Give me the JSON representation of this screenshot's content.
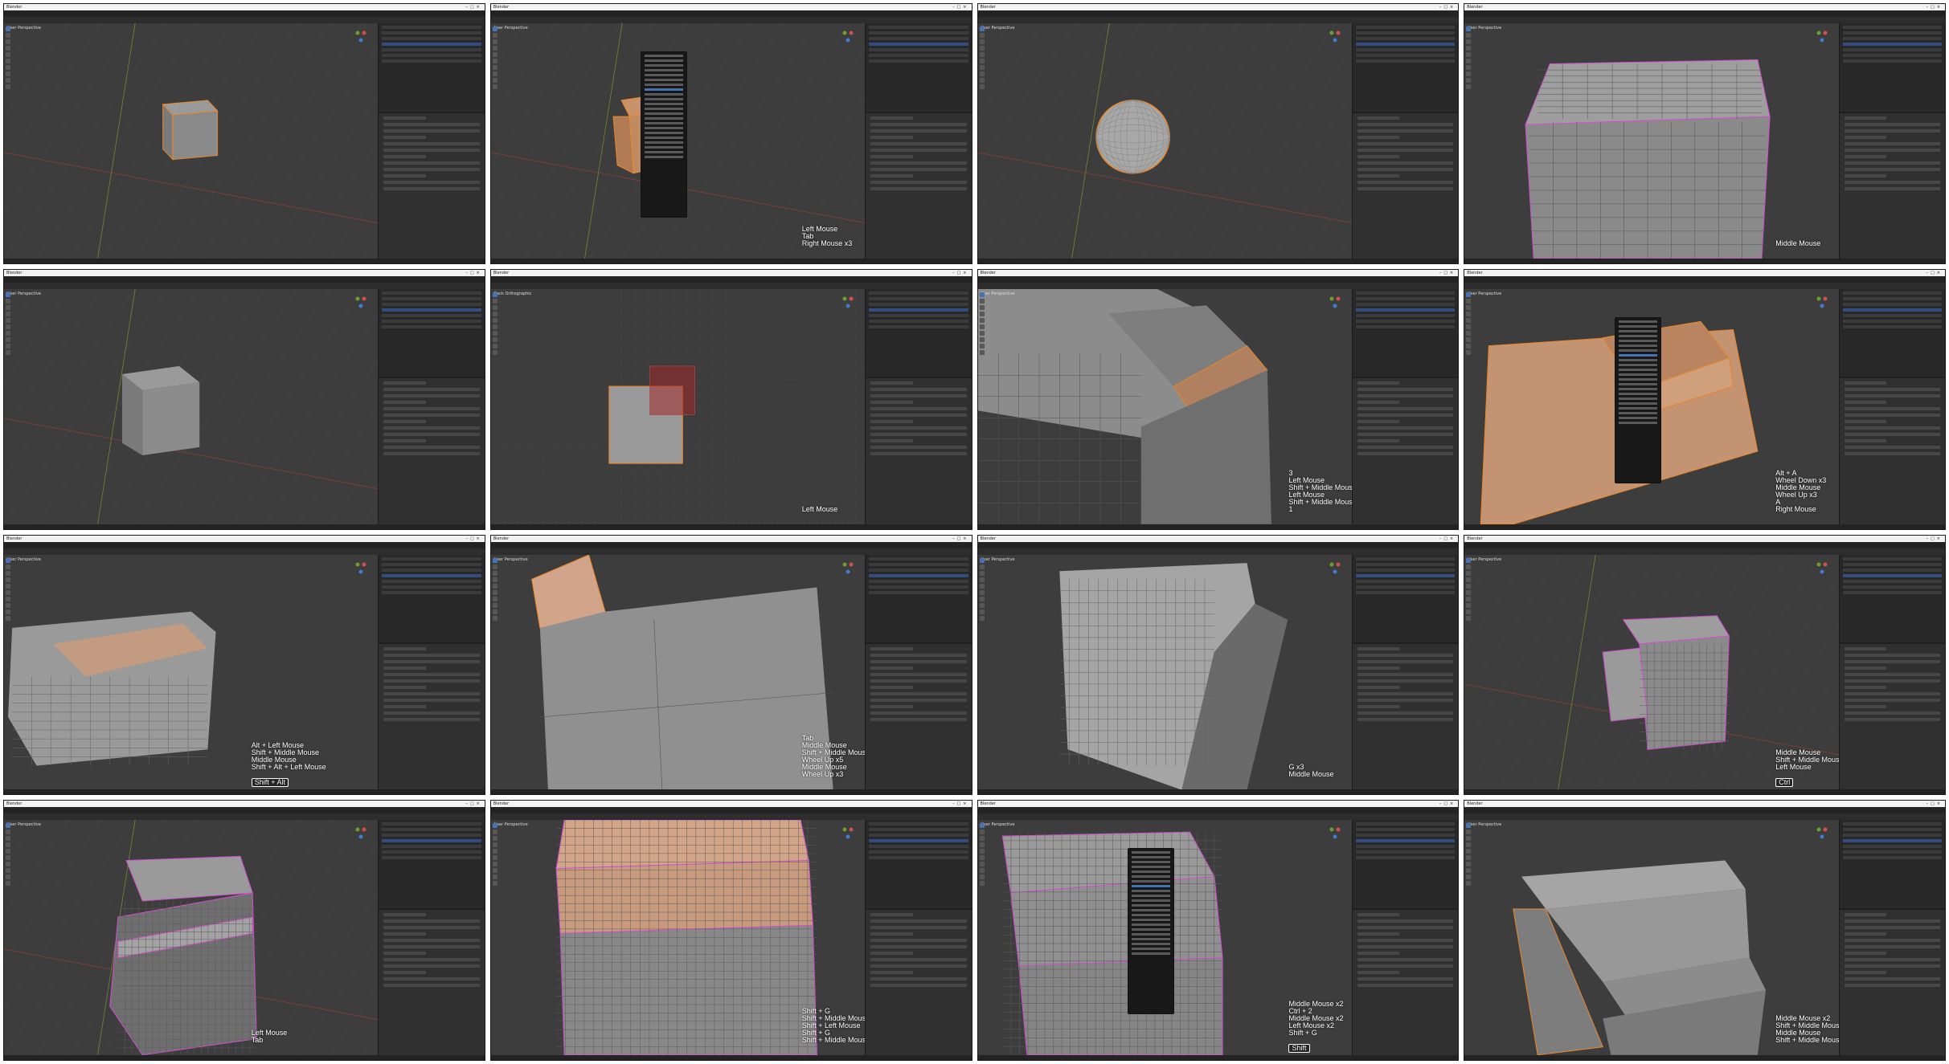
{
  "app": "Blender",
  "colors": {
    "viewport_bg": "#3d3d3d",
    "grid_line": "#444444",
    "x_axis": "#8f3b3b",
    "y_axis": "#6c8a2b",
    "selection_orange": "#e8872c",
    "edge_pink": "#d24fd0",
    "panel_bg": "#303030",
    "highlight_blue": "#4772b3",
    "mesh_gray": "#8c8c8c"
  },
  "frames": [
    {
      "id": "f1",
      "window_title": "Blender",
      "viewport_label": "User Perspective",
      "scene": "cube-selected",
      "menu": false,
      "keys": []
    },
    {
      "id": "f2",
      "window_title": "Blender",
      "viewport_label": "User Perspective",
      "scene": "cube-edit-menu",
      "menu": true,
      "keys": [
        "Left Mouse",
        "Tab",
        "Right Mouse x3"
      ]
    },
    {
      "id": "f3",
      "window_title": "Blender",
      "viewport_label": "User Perspective",
      "scene": "sphere",
      "menu": false,
      "keys": []
    },
    {
      "id": "f4",
      "window_title": "Blender",
      "viewport_label": "User Perspective",
      "scene": "subdiv-cube",
      "menu": false,
      "keys": [
        "Middle Mouse"
      ]
    },
    {
      "id": "f5",
      "window_title": "Blender",
      "viewport_label": "User Perspective",
      "scene": "cube-plain",
      "menu": false,
      "keys": []
    },
    {
      "id": "f6",
      "window_title": "Blender",
      "viewport_label": "Back Orthographic",
      "scene": "box-select",
      "menu": false,
      "keys": [
        "Left Mouse"
      ]
    },
    {
      "id": "f7",
      "window_title": "Blender",
      "viewport_label": "User Perspective",
      "scene": "step-closeup",
      "menu": false,
      "keys": [
        "3",
        "Left Mouse",
        "Shift + Middle Mouse",
        "Left Mouse",
        "Shift + Middle Mouse",
        "1"
      ]
    },
    {
      "id": "f8",
      "window_title": "Blender",
      "viewport_label": "User Perspective",
      "scene": "step-menu",
      "menu": true,
      "keys": [
        "Alt + A",
        "Wheel Down x3",
        "Middle Mouse",
        "Wheel Up x3",
        "A",
        "Right Mouse"
      ]
    },
    {
      "id": "f9",
      "window_title": "Blender",
      "viewport_label": "User Perspective",
      "scene": "rounded-step",
      "menu": false,
      "keys": [
        "Alt + Left Mouse",
        "Shift + Middle Mouse",
        "Middle Mouse",
        "Shift + Alt + Left Mouse"
      ],
      "boxed": "Shift + Alt"
    },
    {
      "id": "f10",
      "window_title": "Blender",
      "viewport_label": "User Perspective",
      "scene": "closeup-seam",
      "menu": false,
      "keys": [
        "Tab",
        "Middle Mouse",
        "Shift + Middle Mouse",
        "Wheel Up x5",
        "Middle Mouse",
        "Wheel Up x3"
      ]
    },
    {
      "id": "f11",
      "window_title": "Blender",
      "viewport_label": "User Perspective",
      "scene": "dense-corner",
      "menu": false,
      "keys": [
        "G x3",
        "Middle Mouse"
      ]
    },
    {
      "id": "f12",
      "window_title": "Blender",
      "viewport_label": "User Perspective",
      "scene": "small-steps",
      "menu": false,
      "keys": [
        "Middle Mouse",
        "Shift + Middle Mouse",
        "Left Mouse"
      ],
      "boxed": "Ctrl"
    },
    {
      "id": "f13",
      "window_title": "Blender",
      "viewport_label": "User Perspective",
      "scene": "dense-steps",
      "menu": false,
      "keys": [
        "Left Mouse",
        "Tab"
      ]
    },
    {
      "id": "f14",
      "window_title": "Blender",
      "viewport_label": "User Perspective",
      "scene": "dense-front",
      "menu": false,
      "keys": [
        "Shift + G",
        "Shift + Middle Mouse",
        "Shift + Left Mouse",
        "Shift + G",
        "Shift + Middle Mouse"
      ]
    },
    {
      "id": "f15",
      "window_title": "Blender",
      "viewport_label": "User Perspective",
      "scene": "dense-menu",
      "menu": true,
      "keys": [
        "Middle Mouse x2",
        "Ctrl + 2",
        "Middle Mouse x2",
        "Left Mouse x2",
        "Shift + G"
      ],
      "boxed": "Shift"
    },
    {
      "id": "f16",
      "window_title": "Blender",
      "viewport_label": "User Perspective",
      "scene": "final-steps",
      "menu": false,
      "keys": [
        "Middle Mouse x2",
        "Shift + Middle Mouse",
        "Middle Mouse",
        "Shift + Middle Mouse"
      ]
    }
  ]
}
